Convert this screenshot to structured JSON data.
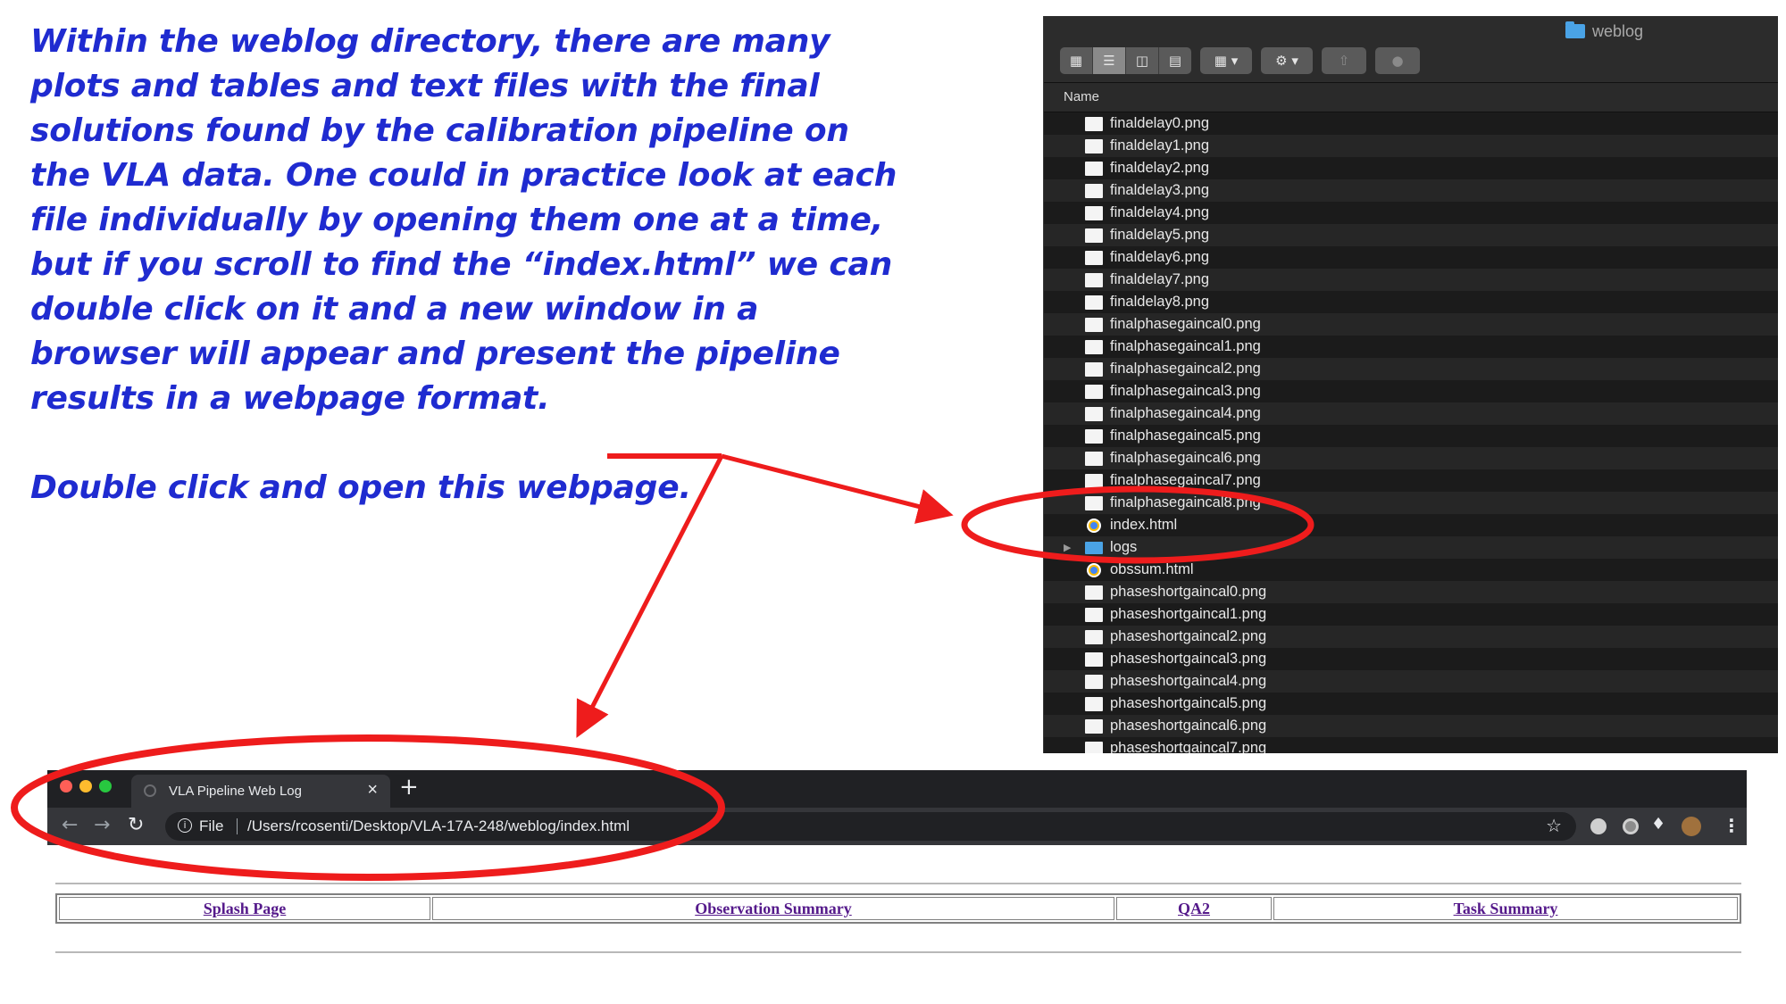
{
  "instructions": {
    "paragraph1": "Within the weblog directory, there are many plots and tables and text files with the final solutions found by the calibration pipeline on the VLA data. One could in practice look at each file individually by opening them one at a time, but if you scroll to find the “index.html” we can double click on it and a new window in a browser will appear and present the pipeline results in a webpage format.",
    "paragraph2": "Double click and open this webpage."
  },
  "finder": {
    "window_title": "weblog",
    "column_header": "Name",
    "files": [
      {
        "name": "finaldelay0.png",
        "icon": "image-file-icon"
      },
      {
        "name": "finaldelay1.png",
        "icon": "image-file-icon"
      },
      {
        "name": "finaldelay2.png",
        "icon": "image-file-icon"
      },
      {
        "name": "finaldelay3.png",
        "icon": "image-file-icon"
      },
      {
        "name": "finaldelay4.png",
        "icon": "image-file-icon"
      },
      {
        "name": "finaldelay5.png",
        "icon": "image-file-icon"
      },
      {
        "name": "finaldelay6.png",
        "icon": "image-file-icon"
      },
      {
        "name": "finaldelay7.png",
        "icon": "image-file-icon"
      },
      {
        "name": "finaldelay8.png",
        "icon": "image-file-icon"
      },
      {
        "name": "finalphasegaincal0.png",
        "icon": "image-file-icon"
      },
      {
        "name": "finalphasegaincal1.png",
        "icon": "image-file-icon"
      },
      {
        "name": "finalphasegaincal2.png",
        "icon": "image-file-icon"
      },
      {
        "name": "finalphasegaincal3.png",
        "icon": "image-file-icon"
      },
      {
        "name": "finalphasegaincal4.png",
        "icon": "image-file-icon"
      },
      {
        "name": "finalphasegaincal5.png",
        "icon": "image-file-icon"
      },
      {
        "name": "finalphasegaincal6.png",
        "icon": "image-file-icon"
      },
      {
        "name": "finalphasegaincal7.png",
        "icon": "image-file-icon"
      },
      {
        "name": "finalphasegaincal8.png",
        "icon": "image-file-icon"
      },
      {
        "name": "index.html",
        "icon": "chrome-html-icon"
      },
      {
        "name": "logs",
        "icon": "folder-icon"
      },
      {
        "name": "obssum.html",
        "icon": "chrome-html-icon"
      },
      {
        "name": "phaseshortgaincal0.png",
        "icon": "image-file-icon"
      },
      {
        "name": "phaseshortgaincal1.png",
        "icon": "image-file-icon"
      },
      {
        "name": "phaseshortgaincal2.png",
        "icon": "image-file-icon"
      },
      {
        "name": "phaseshortgaincal3.png",
        "icon": "image-file-icon"
      },
      {
        "name": "phaseshortgaincal4.png",
        "icon": "image-file-icon"
      },
      {
        "name": "phaseshortgaincal5.png",
        "icon": "image-file-icon"
      },
      {
        "name": "phaseshortgaincal6.png",
        "icon": "image-file-icon"
      },
      {
        "name": "phaseshortgaincal7.png",
        "icon": "image-file-icon"
      }
    ]
  },
  "browser": {
    "tab_title": "VLA Pipeline Web Log",
    "scheme_label": "File",
    "url": "/Users/rcosenti/Desktop/VLA-17A-248/weblog/index.html"
  },
  "webpage": {
    "nav_links": [
      "Splash Page",
      "Observation Summary",
      "QA2",
      "Task Summary"
    ]
  },
  "colors": {
    "instruction_text": "#1f2bd0",
    "annotation_red": "#ee1c1c",
    "link_visited": "#551a8b"
  }
}
